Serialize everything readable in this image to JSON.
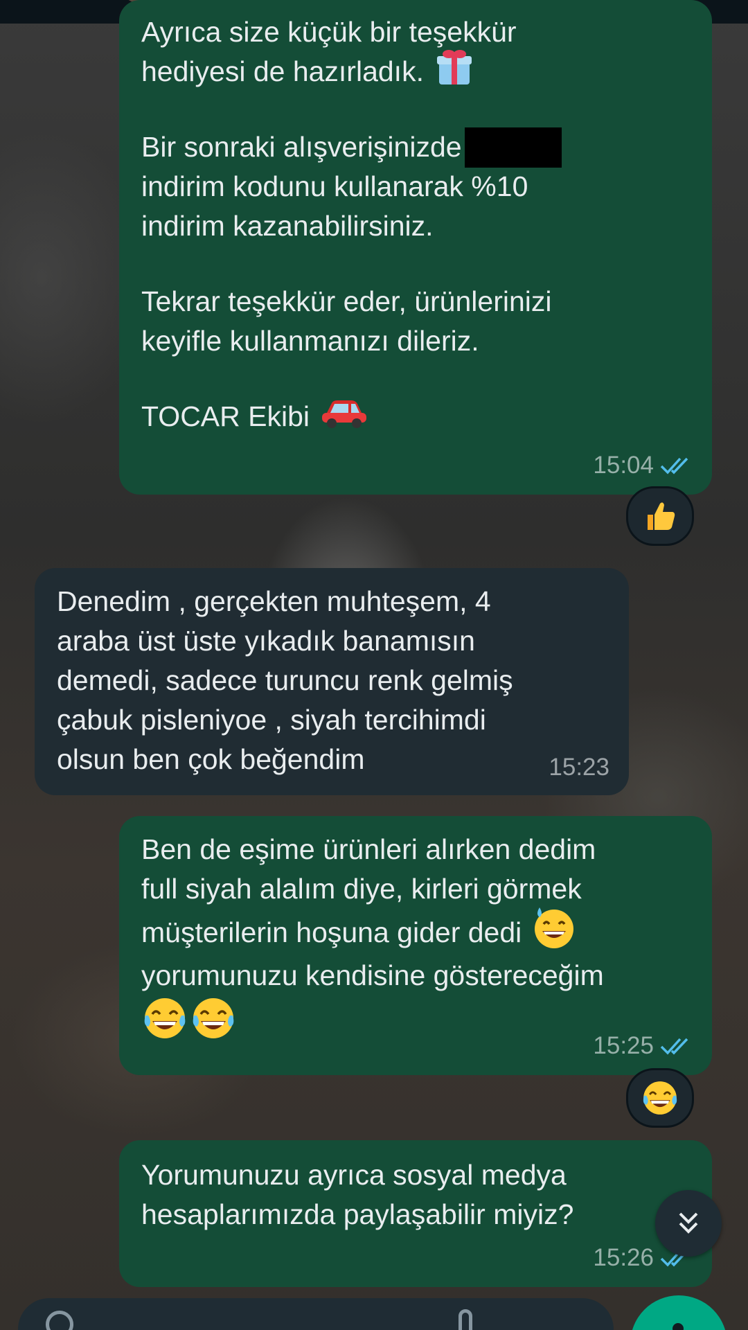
{
  "messages": [
    {
      "direction": "outgoing",
      "lines": [
        "Ayrıca size küçük bir teşekkür",
        "hediyesi de hazırladık.",
        "",
        "Bir sonraki alışverişinizde",
        "indirim kodunu kullanarak %10",
        "indirim kazanabilirsiniz.",
        "",
        "Tekrar teşekkür eder, ürünlerinizi",
        "keyifle kullanmanızı dileriz.",
        "",
        "TOCAR Ekibi"
      ],
      "inline_emojis": [
        "gift-emoji",
        "car-emoji"
      ],
      "redacted_code": true,
      "time": "15:04",
      "status": "read",
      "reaction": "thumbs-up-emoji"
    },
    {
      "direction": "incoming",
      "lines": [
        "Denedim , gerçekten muhteşem, 4",
        "araba üst üste yıkadık banamısın",
        "demedi, sadece turuncu renk gelmiş",
        "çabuk pisleniyoe , siyah tercihimdi",
        "olsun ben çok beğendim"
      ],
      "time": "15:23"
    },
    {
      "direction": "outgoing",
      "lines": [
        "Ben de eşime ürünleri alırken dedim",
        "full siyah alalım diye, kirleri görmek",
        "müşterilerin hoşuna gider dedi",
        "yorumunuzu kendisine göstereceğim"
      ],
      "inline_emojis": [
        "sweat-smile-emoji",
        "tears-of-joy-emoji",
        "tears-of-joy-emoji"
      ],
      "time": "15:25",
      "status": "read",
      "reaction": "tears-of-joy-emoji"
    },
    {
      "direction": "outgoing",
      "lines": [
        "Yorumunuzu ayrıca sosyal medya",
        "hesaplarımızda paylaşabilir miyiz?"
      ],
      "time": "15:26",
      "status": "read"
    }
  ],
  "colors": {
    "outgoing_bubble": "#144d37",
    "incoming_bubble": "#202c33",
    "read_tick": "#53bdeb",
    "accent": "#00a884"
  },
  "icons": {
    "scroll_down": "double-chevron-down-icon",
    "composer_emoji": "emoji-icon",
    "attach": "paperclip-icon",
    "mic": "mic-icon"
  }
}
